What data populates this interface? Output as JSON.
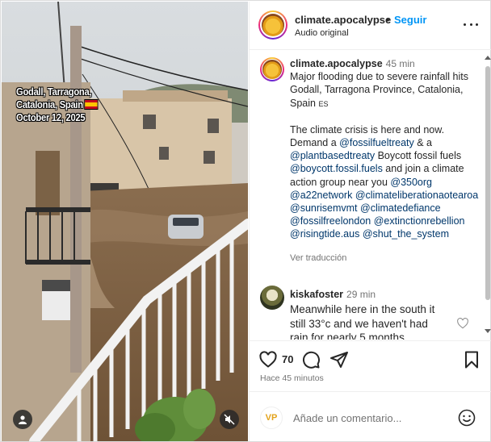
{
  "video": {
    "overlay_lines": [
      "Godall, Tarragona,",
      "Catalonia, Spain",
      "October 12, 2025"
    ],
    "flag_icon": "spain-flag-icon",
    "user_icon": "user-icon",
    "mute_icon": "speaker-muted-icon"
  },
  "header": {
    "username": "climate.apocalypse",
    "separator": "•",
    "follow_label": "Seguir",
    "audio_label": "Audio original",
    "more_icon": "more-options-icon"
  },
  "caption": {
    "username": "climate.apocalypse",
    "time": "45 min",
    "line1": "Major flooding due to severe rainfall hits Godall, Tarragona Province, Catalonia, Spain",
    "flag_code": "ES",
    "para2_a": "The climate crisis is here and now. Demand a ",
    "mention1": "@fossilfueltreaty",
    "para2_b": " & a ",
    "mention2": "@plantbasedtreaty",
    "para2_c": " Boycott fossil fuels ",
    "mention3": "@boycott.fossil.fuels",
    "para2_d": " and join a climate action group near you ",
    "mention4": "@350org",
    "mention5": "@a22network",
    "mention6": "@climateliberationaotearoa",
    "mention7": "@sunrisemvmt",
    "mention8": "@climatedefiance",
    "mention9": "@fossilfreelondon",
    "mention10": "@extinctionrebellion",
    "mention11": "@risingtide.aus",
    "mention12": "@shut_the_system",
    "translate_label": "Ver traducción"
  },
  "reply": {
    "username": "kiskafoster",
    "time": "29 min",
    "text": "Meanwhile here in the south it still 33°c and we haven't had rain for nearly 5 months"
  },
  "actions": {
    "like_count": "70",
    "ago": "Hace 45 minutos",
    "like_icon": "heart-icon",
    "comment_icon": "comment-bubble-icon",
    "share_icon": "share-paper-plane-icon",
    "save_icon": "bookmark-icon"
  },
  "add_comment": {
    "avatar_text": "VP",
    "placeholder": "Añade un comentario...",
    "emoji_icon": "emoji-smile-icon"
  },
  "colors": {
    "link": "#00376b",
    "follow": "#0095f6",
    "muted": "#737373",
    "text": "#262626"
  }
}
